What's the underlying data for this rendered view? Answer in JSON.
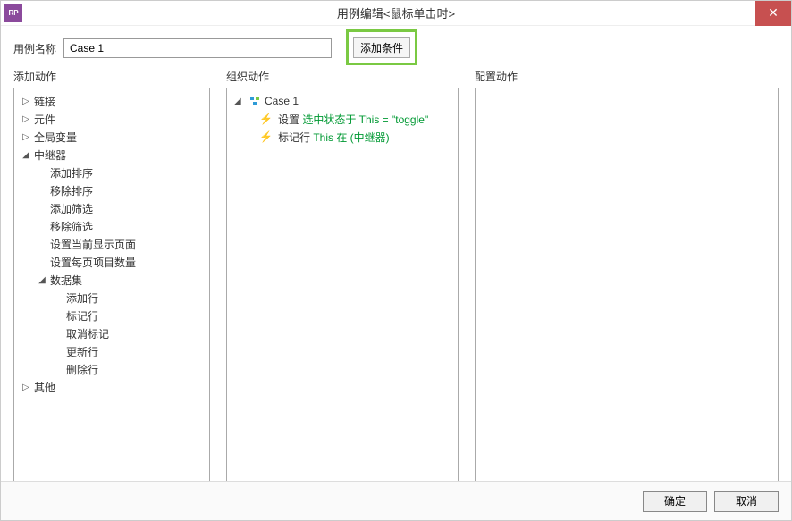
{
  "window": {
    "app_icon_text": "RP",
    "title": "用例编辑<鼠标单击时>",
    "close_glyph": "✕"
  },
  "name_row": {
    "label": "用例名称",
    "value": "Case 1",
    "add_condition_label": "添加条件"
  },
  "columns": {
    "add_actions_header": "添加动作",
    "organize_actions_header": "组织动作",
    "configure_actions_header": "配置动作"
  },
  "add_actions_tree": {
    "links": "链接",
    "widgets": "元件",
    "globals": "全局变量",
    "repeater": "中继器",
    "repeater_children": {
      "add_sort": "添加排序",
      "remove_sort": "移除排序",
      "add_filter": "添加筛选",
      "remove_filter": "移除筛选",
      "set_current_page": "设置当前显示页面",
      "set_items_per_page": "设置每页项目数量",
      "dataset": "数据集",
      "dataset_children": {
        "add_row": "添加行",
        "mark_row": "标记行",
        "unmark": "取消标记",
        "update_row": "更新行",
        "delete_row": "删除行"
      }
    },
    "other": "其他"
  },
  "organize": {
    "case_name": "Case 1",
    "action1": {
      "prefix": "设置",
      "green": "选中状态于 This = \"toggle\""
    },
    "action2": {
      "prefix": "标记行",
      "green": "This 在 (中继器)"
    }
  },
  "buttons": {
    "ok": "确定",
    "cancel": "取消"
  },
  "glyphs": {
    "collapsed": "▷",
    "expanded": "◢",
    "bolt": "⚡"
  }
}
